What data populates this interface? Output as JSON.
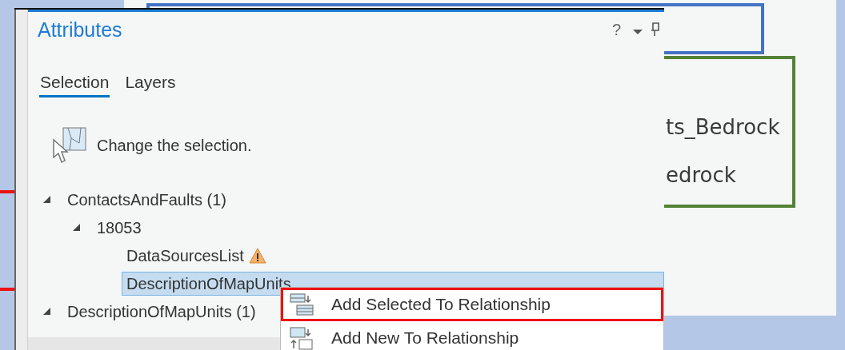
{
  "background_window": {
    "labels": [
      "ts_Bedrock",
      "edrock"
    ]
  },
  "panel": {
    "title": "Attributes",
    "help": "?",
    "tabs": [
      {
        "label": "Selection",
        "selected": true
      },
      {
        "label": "Layers",
        "selected": false
      }
    ],
    "hint": "Change the selection.",
    "tree": [
      {
        "label": "ContactsAndFaults (1)",
        "expanded": true,
        "selected": false,
        "children": [
          {
            "label": "18053",
            "expanded": true,
            "selected": false,
            "children": [
              {
                "label": "DataSourcesList",
                "warning": true,
                "selected": false
              },
              {
                "label": "DescriptionOfMapUnits",
                "warning": false,
                "selected": true
              }
            ]
          }
        ]
      },
      {
        "label": "DescriptionOfMapUnits (1)",
        "expanded": true,
        "selected": false
      }
    ]
  },
  "context_menu": [
    {
      "label": "Add Selected To Relationship",
      "highlighted": true,
      "kind": "add-selected"
    },
    {
      "label": "Add New To Relationship",
      "highlighted": false,
      "kind": "add-new"
    }
  ]
}
